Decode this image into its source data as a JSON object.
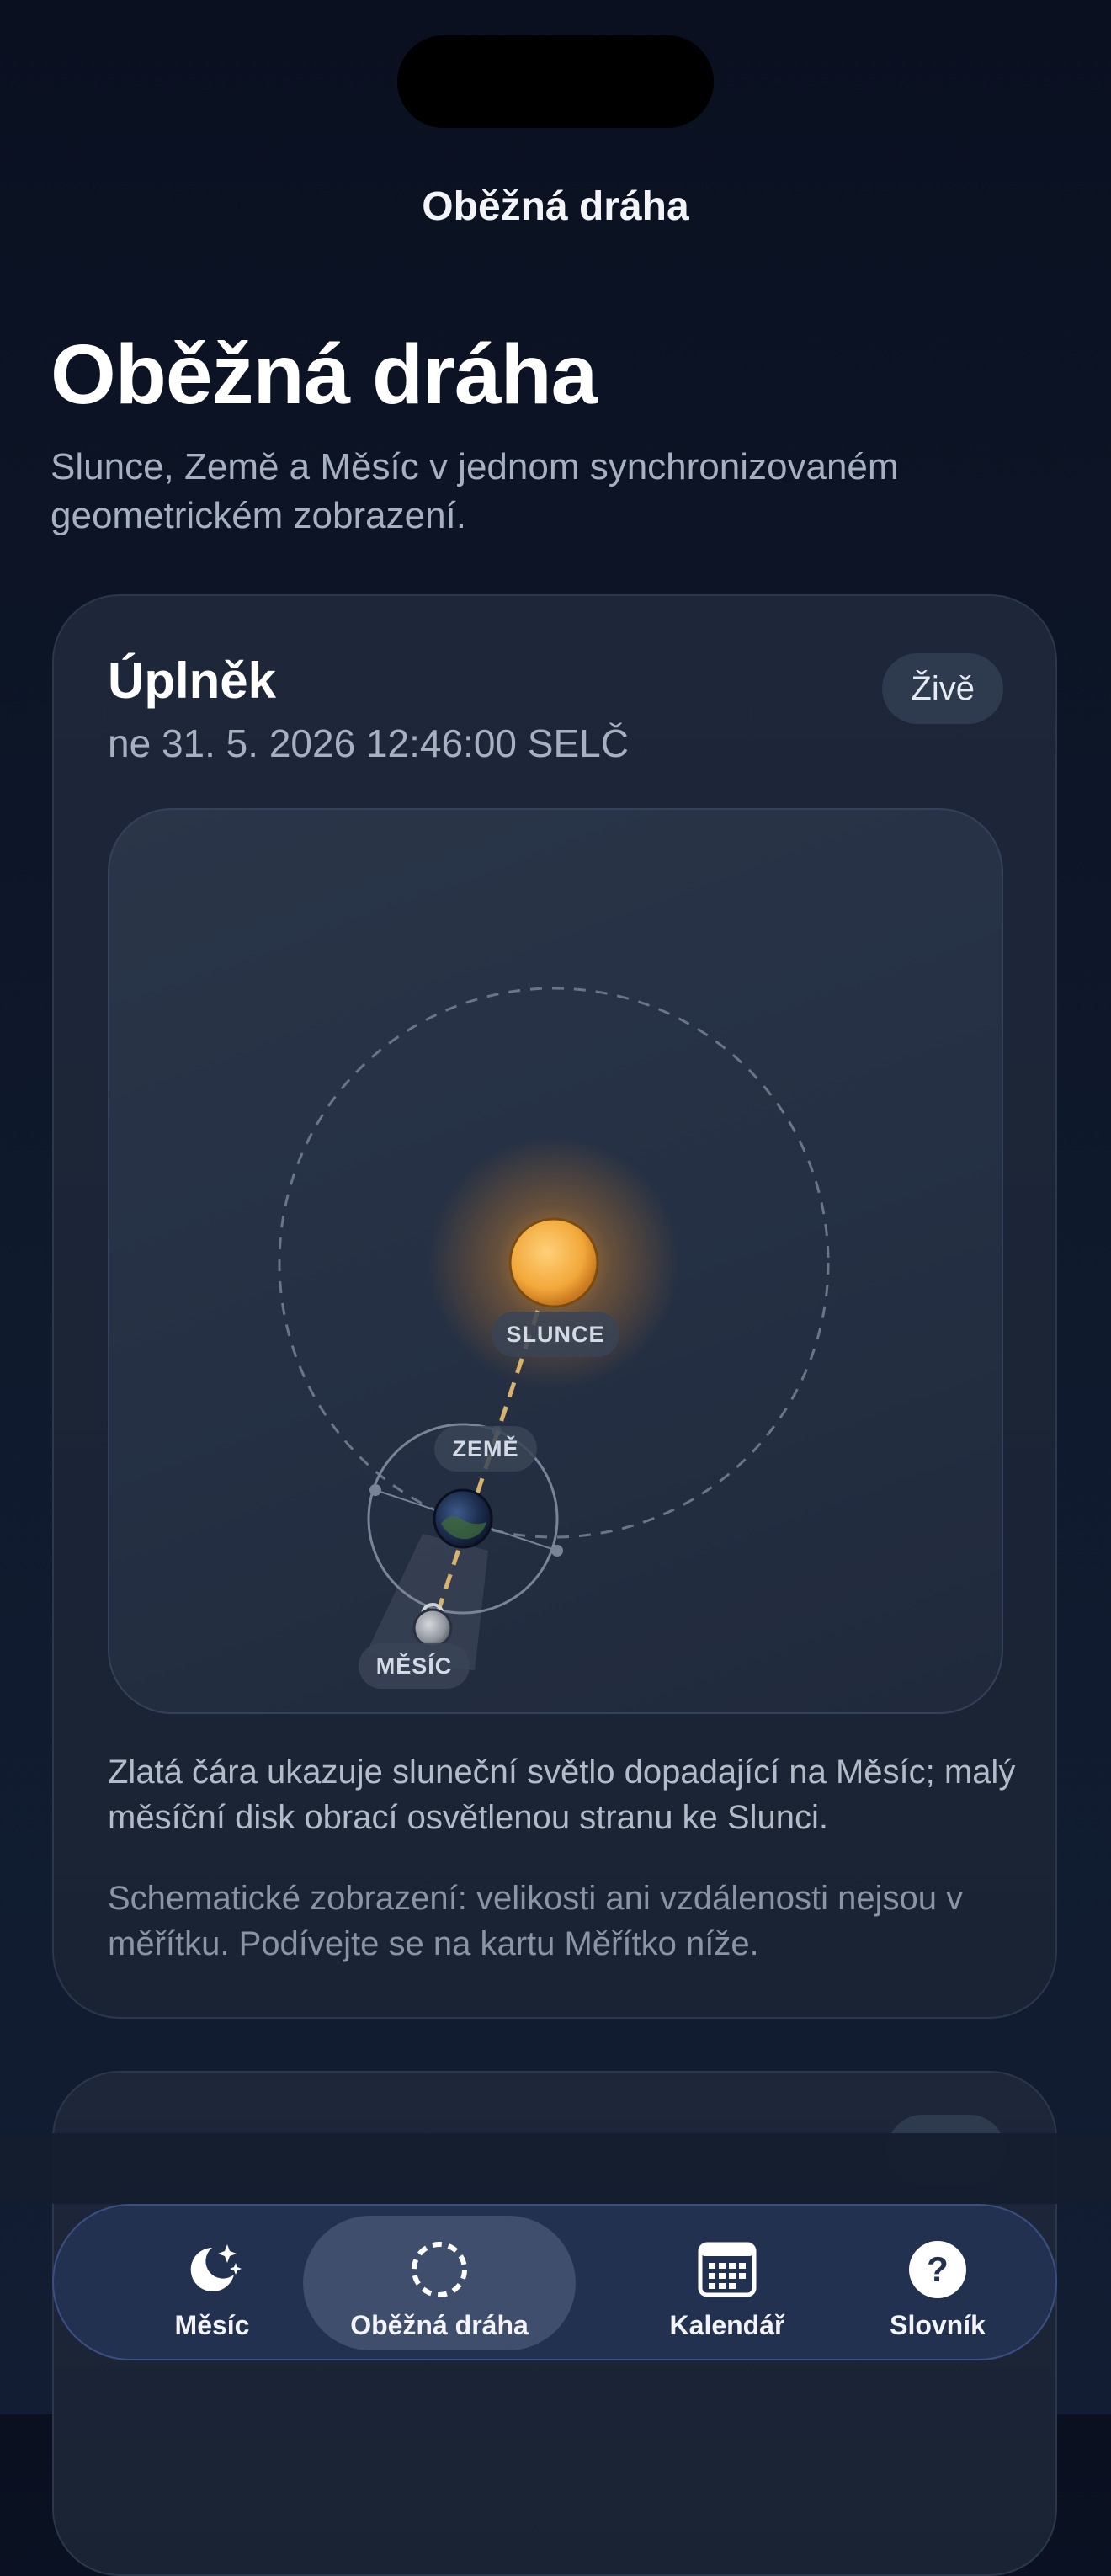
{
  "nav": {
    "title": "Oběžná dráha"
  },
  "header": {
    "title": "Oběžná dráha",
    "subtitle": "Slunce, Země a Měsíc v jednom synchronizovaném geometrickém zobrazení."
  },
  "orbit_card": {
    "phase": "Úplněk",
    "datetime": "ne 31. 5. 2026 12:46:00 SELČ",
    "live_label": "Živě",
    "diagram": {
      "sun_label": "SLUNCE",
      "earth_label": "ZEMĚ",
      "moon_label": "MĚSÍC"
    },
    "note_primary": "Zlatá čára ukazuje sluneční světlo dopadající na Měsíc; malý měsíční disk obrací osvětlenou stranu ke Slunci.",
    "note_secondary": "Schematické zobrazení: velikosti ani vzdálenosti nejsou v měřítku. Podívejte se na kartu Měřítko níže."
  },
  "tabs": [
    {
      "label": "Měsíc",
      "icon": "moon-stars-icon",
      "active": false
    },
    {
      "label": "Oběžná dráha",
      "icon": "orbit-icon",
      "active": true
    },
    {
      "label": "Kalendář",
      "icon": "calendar-icon",
      "active": false
    },
    {
      "label": "Slovník",
      "icon": "help-icon",
      "active": false
    }
  ],
  "colors": {
    "background": "#0a1020",
    "card": "#1d2739",
    "sun": "#f2a83a",
    "light_ray": "#d9b36c",
    "tab_active": "#3b4f85"
  }
}
